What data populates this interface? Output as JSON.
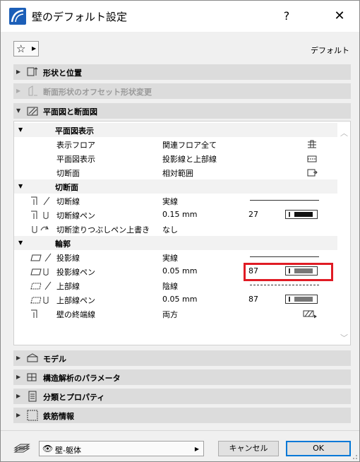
{
  "window": {
    "title": "壁のデフォルト設定",
    "help_label": "?",
    "close_label": "✕"
  },
  "toolbar": {
    "favorites_icon": "star-icon",
    "default_label": "デフォルト"
  },
  "sections": [
    {
      "label": "形状と位置",
      "expanded": false,
      "enabled": true,
      "icon": "geometry-icon"
    },
    {
      "label": "断面形状のオフセット形状変更",
      "expanded": false,
      "enabled": false,
      "icon": "profile-offset-icon"
    },
    {
      "label": "平面図と断面図",
      "expanded": true,
      "enabled": true,
      "icon": "floorplan-section-icon"
    },
    {
      "label": "モデル",
      "expanded": false,
      "enabled": true,
      "icon": "model-icon"
    },
    {
      "label": "構造解析のパラメータ",
      "expanded": false,
      "enabled": true,
      "icon": "structural-icon"
    },
    {
      "label": "分類とプロパティ",
      "expanded": false,
      "enabled": true,
      "icon": "classification-icon"
    },
    {
      "label": "鉄筋情報",
      "expanded": false,
      "enabled": true,
      "icon": "rebar-icon"
    }
  ],
  "panel": {
    "groups": [
      {
        "label": "平面図表示",
        "rows": [
          {
            "name": "表示フロア",
            "value": "関連フロア全て"
          },
          {
            "name": "平面図表示",
            "value": "投影線と上部線"
          },
          {
            "name": "切断面",
            "value": "相対範囲"
          }
        ]
      },
      {
        "label": "切断面",
        "rows": [
          {
            "name": "切断線",
            "value": "実線"
          },
          {
            "name": "切断線ペン",
            "value": "0.15 mm",
            "pen": "27"
          },
          {
            "name": "切断塗りつぶしペン上書き",
            "value": "なし"
          }
        ]
      },
      {
        "label": "輪郭",
        "rows": [
          {
            "name": "投影線",
            "value": "実線"
          },
          {
            "name": "投影線ペン",
            "value": "0.05 mm",
            "pen": "87"
          },
          {
            "name": "上部線",
            "value": "陰線"
          },
          {
            "name": "上部線ペン",
            "value": "0.05 mm",
            "pen": "87"
          },
          {
            "name": "壁の終端線",
            "value": "両方"
          }
        ]
      }
    ]
  },
  "footer": {
    "layer_value": "壁-躯体",
    "cancel_label": "キャンセル",
    "ok_label": "OK"
  },
  "colors": {
    "accent": "#0078d7",
    "highlight": "#e01b24",
    "pen_black": "#111111",
    "pen_gray": "#777777"
  }
}
